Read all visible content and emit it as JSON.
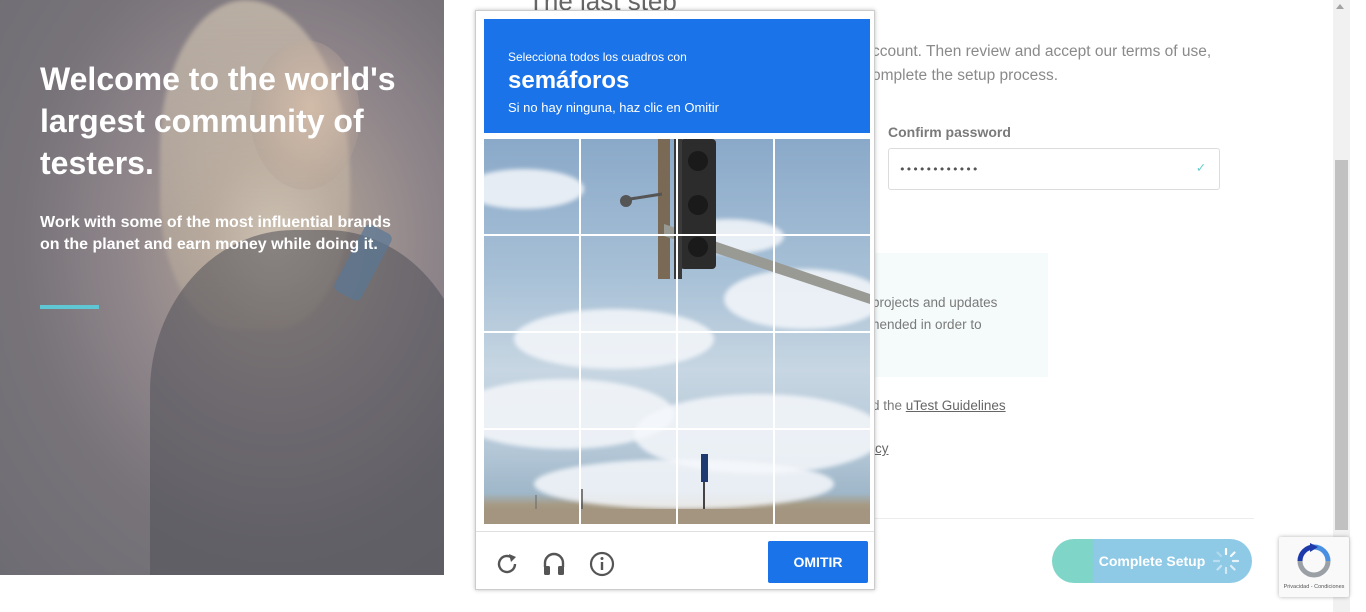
{
  "hero": {
    "title": "Welcome to the world's largest community of testers.",
    "subtitle": "Work with some of the most influential brands on the planet and earn money while doing it."
  },
  "main": {
    "heading": "The last step",
    "intro": "ccount. Then review and accept our terms of use, omplete the setup process.",
    "confirm_label": "Confirm password",
    "confirm_value": "••••••••••••",
    "info_text": "projects and updates nended in order to",
    "guidelines_prefix": "d the ",
    "guidelines_link": "uTest Guidelines",
    "policy_fragment": "icy",
    "complete_button": "Complete Setup"
  },
  "captcha": {
    "instruction": "Selecciona todos los cuadros con",
    "keyword": "semáforos",
    "note": "Si no hay ninguna, haz clic en Omitir",
    "skip_button": "OMITIR",
    "grid": "4x4"
  },
  "recaptcha_badge": {
    "terms": "Privacidad - Condiciones"
  },
  "colors": {
    "captcha_blue": "#1a73e8",
    "accent_teal": "#5fc7d4",
    "button_green": "#7fd6c8",
    "button_blue": "#8ec9e6"
  },
  "icons": [
    "reload-icon",
    "headphones-icon",
    "info-icon",
    "check-icon",
    "spinner-icon",
    "recaptcha-logo-icon"
  ]
}
